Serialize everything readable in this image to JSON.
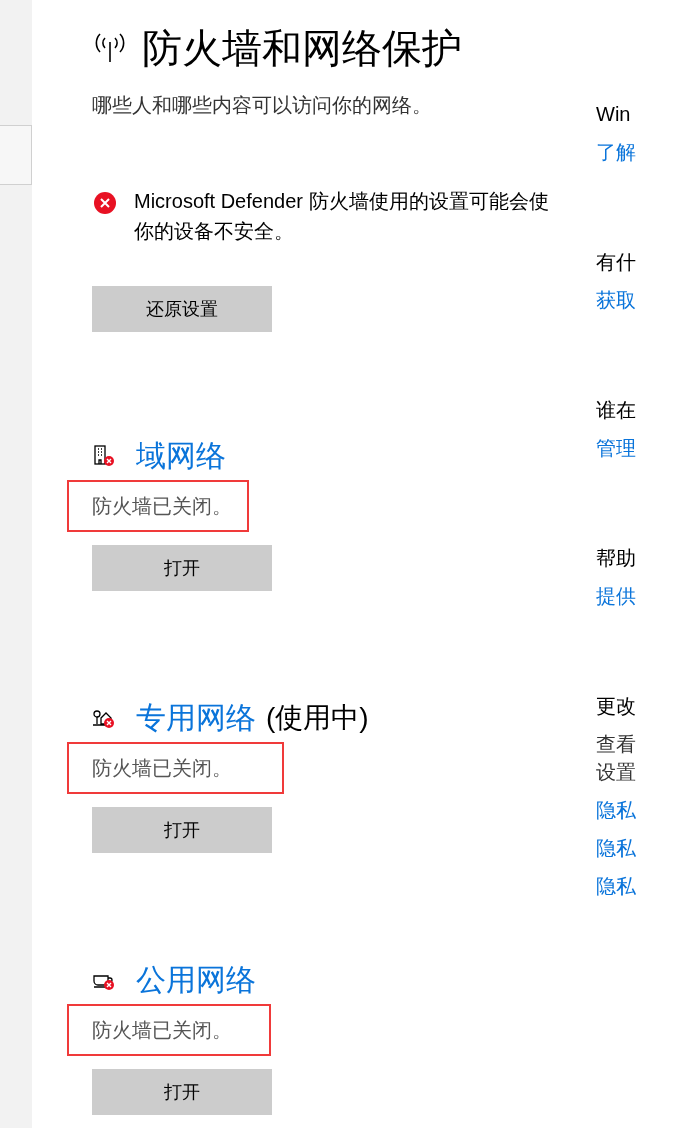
{
  "sidebar": {
    "items": [
      {
        "selected": true
      }
    ]
  },
  "page": {
    "title": "防火墙和网络保护",
    "subtitle": "哪些人和哪些内容可以访问你的网络。"
  },
  "alert": {
    "message": "Microsoft Defender 防火墙使用的设置可能会使你的设备不安全。",
    "button": "还原设置"
  },
  "networks": [
    {
      "kind": "domain",
      "name": "域网络",
      "status": "防火墙已关闭。",
      "highlighted": true,
      "button": "打开"
    },
    {
      "kind": "private",
      "name": "专用网络",
      "suffix": "(使用中)",
      "status": "防火墙已关闭。",
      "highlighted": true,
      "button": "打开"
    },
    {
      "kind": "public",
      "name": "公用网络",
      "status": "防火墙已关闭。",
      "highlighted": true,
      "button": "打开"
    }
  ],
  "side_panel": [
    {
      "heading": "Win",
      "links": [
        "了解"
      ]
    },
    {
      "heading": "有什",
      "links": [
        "获取"
      ]
    },
    {
      "heading": "谁在",
      "links": [
        "管理"
      ]
    },
    {
      "heading": "帮助",
      "links": [
        "提供"
      ]
    },
    {
      "heading": "更改",
      "lines": [
        "查看",
        "设置"
      ],
      "links": [
        "隐私",
        "隐私",
        "隐私"
      ]
    }
  ]
}
